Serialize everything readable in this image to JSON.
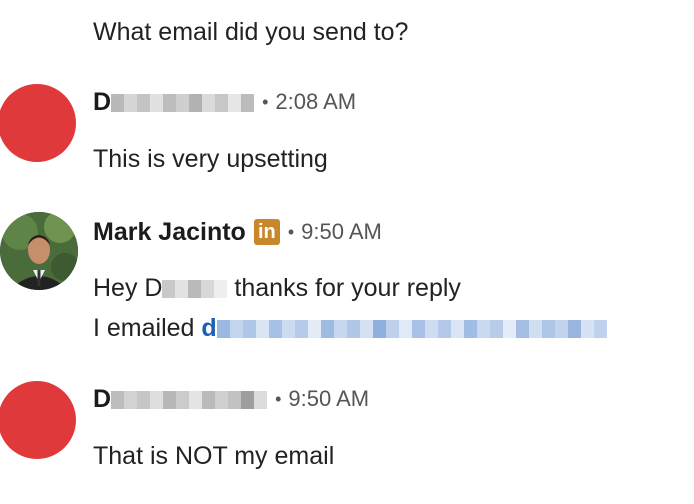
{
  "messages": [
    {
      "text": "What email did you send to?"
    },
    {
      "sender_initial": "D",
      "time": "2:08 AM",
      "text": "This is very upsetting",
      "avatar_color": "#e0393b"
    },
    {
      "sender": "Mark Jacinto",
      "badge": "in",
      "time": "9:50 AM",
      "line1_prefix": "Hey D",
      "line1_suffix": "thanks for your reply",
      "line2_prefix": "I emailed ",
      "line2_link_initial": "d"
    },
    {
      "sender_initial": "D",
      "time": "9:50 AM",
      "text": "That is NOT my email",
      "avatar_color": "#e0393b"
    }
  ],
  "colors": {
    "avatar_red": "#e0393b",
    "linkedin_badge": "#c9872b",
    "link_blue": "#1d5fb8"
  },
  "icons": {
    "linkedin": "linkedin-premium-icon"
  }
}
